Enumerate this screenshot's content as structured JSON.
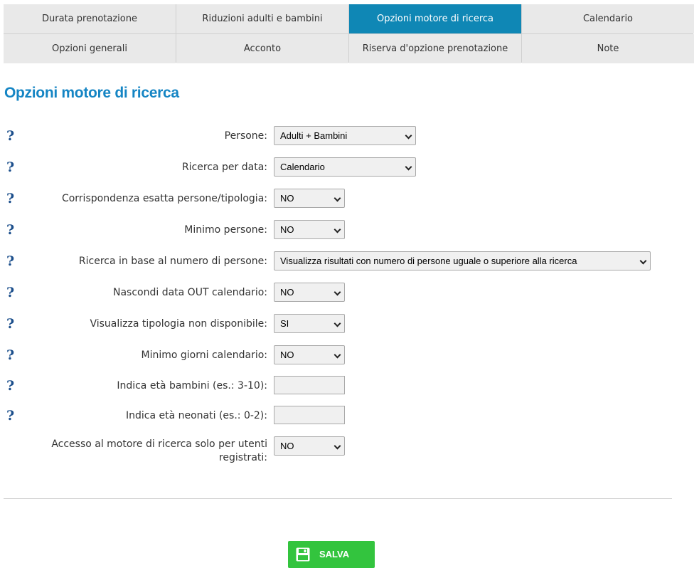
{
  "tabs": [
    {
      "label": "Durata prenotazione",
      "active": false
    },
    {
      "label": "Riduzioni adulti e bambini",
      "active": false
    },
    {
      "label": "Opzioni motore di ricerca",
      "active": true
    },
    {
      "label": "Calendario",
      "active": false
    },
    {
      "label": "Opzioni generali",
      "active": false
    },
    {
      "label": "Acconto",
      "active": false
    },
    {
      "label": "Riserva d'opzione prenotazione",
      "active": false
    },
    {
      "label": "Note",
      "active": false
    }
  ],
  "page_title": "Opzioni motore di ricerca",
  "fields": [
    {
      "label": "Persone:",
      "value": "Adulti + Bambini"
    },
    {
      "label": "Ricerca per data:",
      "value": "Calendario"
    },
    {
      "label": "Corrispondenza esatta persone/tipologia:",
      "value": "NO"
    },
    {
      "label": "Minimo persone:",
      "value": "NO"
    },
    {
      "label": "Ricerca in base al numero di persone:",
      "value": "Visualizza risultati con numero di persone uguale o superiore alla ricerca"
    },
    {
      "label": "Nascondi data OUT calendario:",
      "value": "NO"
    },
    {
      "label": "Visualizza tipologia non disponibile:",
      "value": "SI"
    },
    {
      "label": "Minimo giorni calendario:",
      "value": "NO"
    },
    {
      "label": "Indica età bambini (es.: 3-10):",
      "value": ""
    },
    {
      "label": "Indica età neonati (es.: 0-2):",
      "value": ""
    },
    {
      "label": "Accesso al motore di ricerca solo per utenti registrati:",
      "value": "NO"
    }
  ],
  "help_glyph": "?",
  "save_label": "SALVA",
  "colors": {
    "accent": "#0f87b5",
    "title": "#1585c4",
    "save": "#33c43e",
    "help": "#1c4f8c"
  },
  "icons": {
    "help": "help-question-icon",
    "save": "floppy-disk-icon"
  }
}
